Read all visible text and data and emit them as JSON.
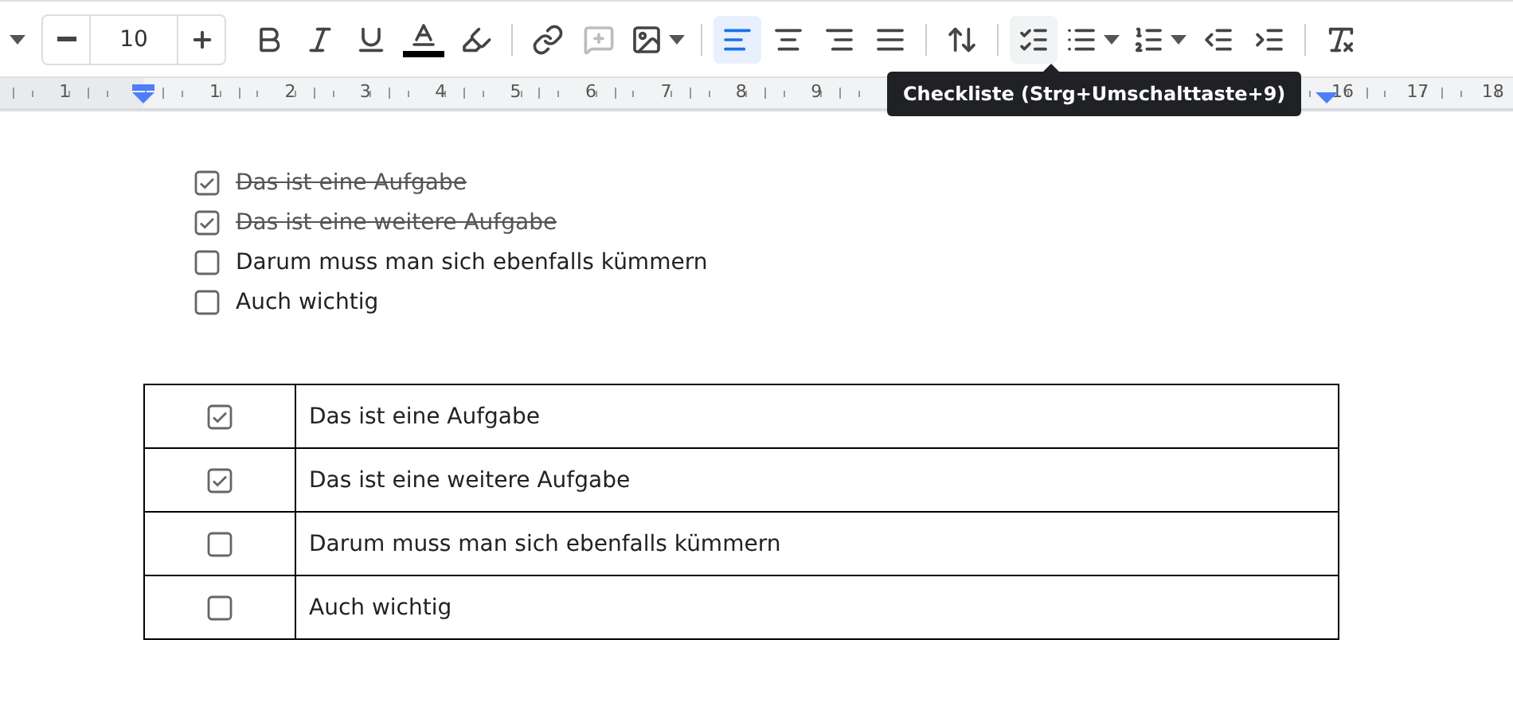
{
  "toolbar": {
    "font_size": {
      "value": "10"
    },
    "buttons": [
      {
        "kind": "bold",
        "selected": false,
        "disabled": false
      },
      {
        "kind": "italic",
        "selected": false,
        "disabled": false
      },
      {
        "kind": "underline",
        "selected": false,
        "disabled": false
      },
      {
        "kind": "text-color",
        "selected": false,
        "disabled": false
      },
      {
        "kind": "highlight",
        "selected": false,
        "disabled": false
      },
      {
        "kind": "sep"
      },
      {
        "kind": "link",
        "selected": false,
        "disabled": false
      },
      {
        "kind": "comment",
        "selected": false,
        "disabled": true
      },
      {
        "kind": "image",
        "selected": false,
        "disabled": false
      },
      {
        "kind": "sep"
      },
      {
        "kind": "align-left",
        "selected": true,
        "disabled": false
      },
      {
        "kind": "align-center",
        "selected": false,
        "disabled": false
      },
      {
        "kind": "align-right",
        "selected": false,
        "disabled": false
      },
      {
        "kind": "align-justify",
        "selected": false,
        "disabled": false
      },
      {
        "kind": "sep"
      },
      {
        "kind": "line-spacing",
        "selected": false,
        "disabled": false
      },
      {
        "kind": "sep"
      },
      {
        "kind": "checklist",
        "selected": false,
        "hovered": true,
        "disabled": false
      },
      {
        "kind": "bullets",
        "selected": false,
        "disabled": false
      },
      {
        "kind": "numbered",
        "selected": false,
        "disabled": false
      },
      {
        "kind": "outdent",
        "selected": false,
        "disabled": false
      },
      {
        "kind": "indent",
        "selected": false,
        "disabled": false
      },
      {
        "kind": "sep"
      },
      {
        "kind": "clear-format",
        "selected": false,
        "disabled": false
      }
    ]
  },
  "ruler": {
    "left_labels": [
      "1"
    ],
    "labels": [
      "1",
      "2",
      "3",
      "4",
      "5",
      "6",
      "7",
      "8",
      "9"
    ],
    "right_labels": [
      "16",
      "17",
      "18"
    ]
  },
  "tooltip": "Checkliste (Strg+Umschalttaste+9)",
  "checklist": [
    {
      "text": "Das ist eine Aufgabe",
      "checked": true
    },
    {
      "text": "Das ist eine weitere Aufgabe",
      "checked": true
    },
    {
      "text": "Darum muss man sich ebenfalls kümmern",
      "checked": false
    },
    {
      "text": "Auch wichtig",
      "checked": false
    }
  ],
  "table": {
    "rows": [
      {
        "checked": true,
        "text": "Das ist eine Aufgabe"
      },
      {
        "checked": true,
        "text": "Das ist eine weitere Aufgabe"
      },
      {
        "checked": false,
        "text": "Darum muss man sich ebenfalls kümmern"
      },
      {
        "checked": false,
        "text": "Auch wichtig"
      }
    ]
  }
}
